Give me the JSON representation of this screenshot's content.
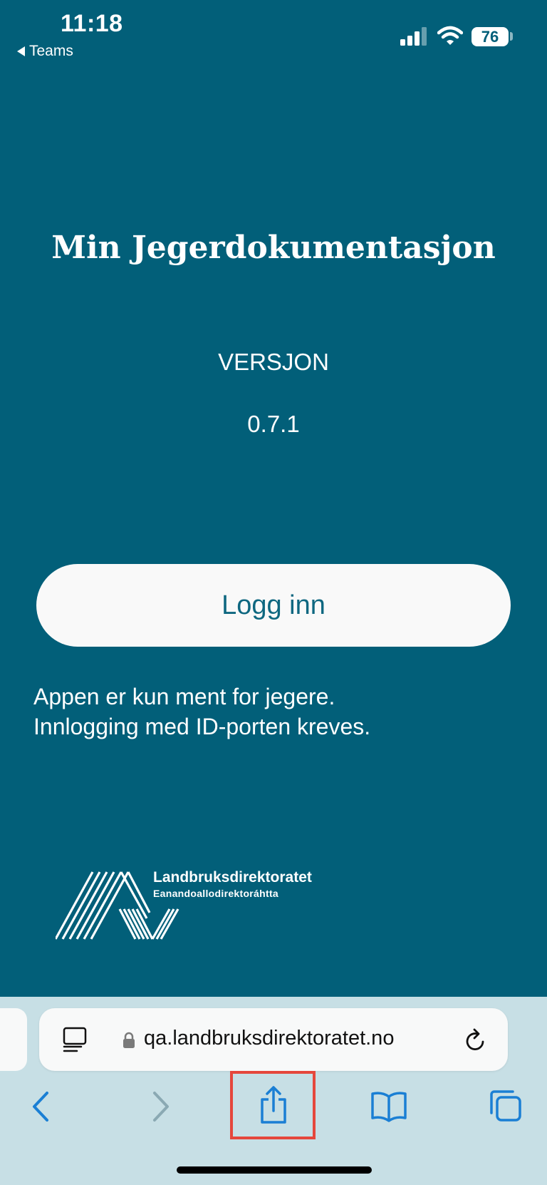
{
  "status_bar": {
    "time": "11:18",
    "back_app": "Teams",
    "battery": "76"
  },
  "main": {
    "title": "Min Jegerdokumentasjon",
    "version_label": "VERSJON",
    "version_number": "0.7.1",
    "login_button": "Logg inn",
    "info_lines": [
      "Appen er kun ment for jegere.",
      "Innlogging med ID-porten kreves."
    ]
  },
  "logo": {
    "name": "Landbruksdirektoratet",
    "subtitle": "Eanandoallodirektoráhtta"
  },
  "browser": {
    "url": "qa.landbruksdirektoratet.no",
    "accent_color": "#1a7fd4",
    "highlight_color": "#e5473c",
    "icons": [
      "reader-mode-icon",
      "lock-icon",
      "reload-icon",
      "back-arrow-icon",
      "forward-arrow-icon",
      "share-icon",
      "bookmarks-icon",
      "tabs-icon"
    ]
  },
  "colors": {
    "background": "#025f79",
    "button_bg": "#f9f9f9",
    "button_text": "#0e6780"
  }
}
